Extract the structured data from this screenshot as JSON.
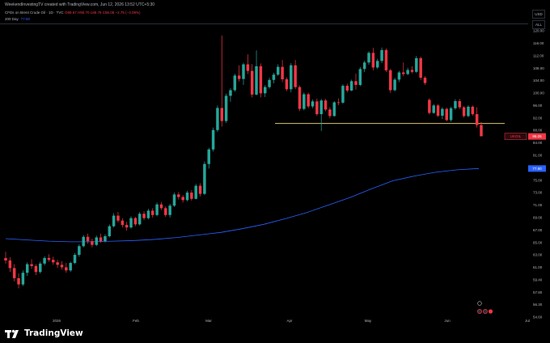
{
  "header": {
    "credit": "WeekendInvestingTV created with TradingView.com, Jun 12, 2026 13:52 UTC+5:30",
    "symbol": "CFDs on Brent Crude Oil · 1D · TVC",
    "ohlc": "O89.67 H90.70 L86.76 C86.05 −2.75 (−3.09%)",
    "ma_label": "200 Day",
    "ma_value": "77.80"
  },
  "right_top": {
    "currency": "USD",
    "mode": "ALL"
  },
  "branding": {
    "name": "TradingView"
  },
  "colors": {
    "up": "#26a69a",
    "down": "#f23645",
    "ma": "#2962ff",
    "level": "#d8c76a",
    "background": "#000000"
  },
  "chart_data": {
    "type": "candlestick",
    "ylim": [
      54.6,
      122
    ],
    "y_ticks": [
      54.6,
      56.3,
      57.8,
      59.4,
      61.0,
      63.0,
      65.0,
      67.0,
      69.0,
      71.0,
      73.0,
      75.0,
      78.0,
      81.0,
      84.0,
      88.0,
      92.0,
      96.0,
      100.0,
      104.0,
      108.0,
      112.0,
      116.0,
      120.0
    ],
    "x_ticks": [
      "2026",
      "Feb",
      "Mar",
      "Apr",
      "May",
      "Jun",
      "Jul"
    ],
    "price_label": {
      "symbol": "UKOIL",
      "value": "86.05"
    },
    "ma_price_label": "77.80",
    "horizontal_level": 90.2,
    "series": [
      {
        "name": "CFDs on Brent Crude Oil",
        "candles": [
          [
            62.5,
            63.5,
            61.6,
            62.1
          ],
          [
            62.1,
            62.6,
            60.4,
            60.9
          ],
          [
            60.9,
            61.5,
            59.2,
            59.6
          ],
          [
            59.6,
            60.2,
            58.3,
            58.8
          ],
          [
            58.8,
            60.6,
            58.6,
            60.3
          ],
          [
            60.3,
            61.8,
            59.9,
            61.5
          ],
          [
            61.5,
            62.3,
            60.8,
            61.2
          ],
          [
            61.2,
            61.5,
            60.0,
            60.4
          ],
          [
            60.4,
            61.9,
            60.2,
            61.6
          ],
          [
            61.6,
            62.8,
            61.3,
            62.5
          ],
          [
            62.5,
            63.1,
            61.9,
            62.2
          ],
          [
            62.2,
            62.7,
            61.4,
            61.8
          ],
          [
            61.8,
            62.2,
            60.9,
            61.4
          ],
          [
            61.4,
            62.0,
            60.7,
            61.0
          ],
          [
            61.0,
            61.7,
            60.3,
            60.6
          ],
          [
            60.6,
            61.9,
            60.4,
            61.7
          ],
          [
            61.7,
            63.3,
            61.5,
            63.0
          ],
          [
            63.0,
            64.7,
            62.7,
            64.4
          ],
          [
            64.4,
            66.2,
            64.2,
            65.9
          ],
          [
            65.9,
            66.4,
            64.8,
            65.2
          ],
          [
            65.2,
            65.6,
            64.2,
            64.6
          ],
          [
            64.6,
            66.1,
            64.4,
            65.8
          ],
          [
            65.8,
            66.4,
            64.9,
            65.2
          ],
          [
            65.2,
            66.3,
            65.0,
            66.0
          ],
          [
            66.0,
            67.9,
            65.8,
            67.6
          ],
          [
            67.6,
            69.7,
            67.4,
            69.3
          ],
          [
            69.3,
            69.9,
            68.2,
            68.5
          ],
          [
            68.5,
            68.9,
            67.4,
            67.8
          ],
          [
            67.8,
            68.3,
            66.9,
            67.4
          ],
          [
            67.4,
            69.2,
            67.2,
            68.9
          ],
          [
            68.9,
            69.1,
            67.6,
            67.9
          ],
          [
            67.9,
            69.9,
            67.7,
            69.6
          ],
          [
            69.6,
            70.0,
            68.6,
            68.9
          ],
          [
            68.9,
            70.4,
            68.7,
            70.1
          ],
          [
            70.1,
            70.5,
            69.0,
            69.4
          ],
          [
            69.4,
            71.4,
            69.2,
            71.1
          ],
          [
            71.1,
            71.5,
            70.2,
            70.5
          ],
          [
            70.5,
            70.8,
            69.1,
            69.4
          ],
          [
            69.4,
            71.2,
            69.0,
            70.9
          ],
          [
            70.9,
            73.0,
            70.7,
            72.7
          ],
          [
            72.7,
            73.1,
            71.9,
            72.3
          ],
          [
            72.3,
            72.6,
            71.4,
            71.8
          ],
          [
            71.8,
            73.3,
            71.6,
            73.0
          ],
          [
            73.0,
            73.4,
            71.7,
            72.0
          ],
          [
            72.0,
            74.4,
            71.9,
            74.1
          ],
          [
            74.1,
            74.5,
            72.4,
            72.8
          ],
          [
            72.8,
            79.5,
            72.6,
            78.9
          ],
          [
            78.9,
            82.8,
            77.8,
            82.4
          ],
          [
            82.4,
            88.9,
            81.9,
            88.1
          ],
          [
            88.1,
            96.0,
            87.5,
            95.2
          ],
          [
            95.2,
            118.5,
            89.2,
            91.0
          ],
          [
            91.0,
            99.8,
            90.4,
            99.1
          ],
          [
            99.1,
            101.5,
            97.2,
            100.9
          ],
          [
            100.9,
            106.2,
            100.4,
            105.6
          ],
          [
            105.6,
            108.9,
            103.7,
            104.5
          ],
          [
            104.5,
            109.7,
            102.6,
            109.2
          ],
          [
            109.2,
            112.4,
            106.1,
            107.1
          ],
          [
            107.1,
            109.3,
            98.6,
            99.5
          ],
          [
            99.5,
            113.7,
            99.2,
            108.6
          ],
          [
            108.6,
            109.5,
            98.6,
            99.9
          ],
          [
            99.9,
            102.5,
            98.7,
            101.9
          ],
          [
            101.9,
            104.9,
            101.4,
            104.2
          ],
          [
            104.2,
            106.5,
            103.1,
            105.9
          ],
          [
            105.9,
            109.2,
            105.5,
            108.4
          ],
          [
            108.4,
            110.6,
            103.5,
            104.4
          ],
          [
            104.4,
            105.0,
            100.6,
            101.2
          ],
          [
            101.2,
            109.6,
            100.2,
            108.9
          ],
          [
            108.9,
            110.6,
            101.3,
            101.9
          ],
          [
            101.9,
            102.4,
            94.2,
            94.9
          ],
          [
            94.9,
            100.2,
            94.4,
            99.6
          ],
          [
            99.6,
            100.1,
            95.1,
            95.7
          ],
          [
            95.7,
            97.9,
            95.1,
            97.3
          ],
          [
            97.3,
            98.2,
            92.6,
            93.2
          ],
          [
            93.2,
            98.1,
            87.8,
            97.6
          ],
          [
            97.6,
            98.1,
            94.1,
            94.7
          ],
          [
            94.7,
            95.4,
            91.9,
            92.6
          ],
          [
            92.6,
            97.4,
            92.4,
            97.0
          ],
          [
            97.0,
            98.3,
            96.1,
            96.9
          ],
          [
            96.9,
            102.8,
            96.5,
            102.3
          ],
          [
            102.3,
            103.0,
            100.2,
            100.8
          ],
          [
            100.8,
            104.3,
            100.6,
            103.8
          ],
          [
            103.8,
            106.2,
            101.1,
            102.6
          ],
          [
            102.6,
            108.3,
            102.2,
            107.7
          ],
          [
            107.7,
            110.4,
            106.7,
            109.8
          ],
          [
            109.8,
            113.4,
            109.1,
            112.9
          ],
          [
            112.9,
            114.5,
            107.3,
            108.2
          ],
          [
            108.2,
            111.0,
            107.7,
            110.3
          ],
          [
            110.3,
            114.6,
            109.6,
            113.8
          ],
          [
            113.8,
            114.3,
            106.7,
            107.3
          ],
          [
            107.3,
            107.8,
            100.0,
            100.9
          ],
          [
            100.9,
            104.9,
            100.5,
            104.3
          ],
          [
            104.3,
            107.1,
            103.5,
            106.6
          ],
          [
            106.6,
            109.8,
            105.4,
            106.1
          ],
          [
            106.1,
            108.1,
            105.7,
            107.4
          ],
          [
            107.4,
            108.6,
            106.3,
            106.8
          ],
          [
            106.8,
            111.9,
            106.4,
            111.2
          ],
          [
            111.2,
            111.7,
            104.2,
            104.9
          ],
          [
            104.9,
            105.4,
            102.6,
            103.2
          ],
          [
            97.8,
            98.3,
            93.1,
            93.6
          ],
          [
            93.6,
            96.5,
            93.3,
            96.0
          ],
          [
            96.0,
            96.4,
            92.3,
            92.7
          ],
          [
            92.7,
            95.4,
            91.6,
            94.9
          ],
          [
            94.9,
            95.3,
            90.9,
            91.3
          ],
          [
            91.3,
            95.6,
            90.8,
            95.1
          ],
          [
            95.1,
            98.0,
            94.6,
            97.4
          ],
          [
            97.4,
            98.1,
            94.8,
            95.4
          ],
          [
            95.4,
            95.8,
            92.1,
            92.6
          ],
          [
            92.6,
            96.1,
            92.2,
            95.6
          ],
          [
            95.6,
            96.0,
            92.7,
            93.2
          ],
          [
            93.2,
            95.4,
            88.9,
            89.7
          ],
          [
            89.7,
            90.7,
            86.8,
            86.1
          ]
        ]
      }
    ],
    "moving_average": {
      "name": "200 Day",
      "values": [
        65.6,
        65.4,
        65.2,
        65.1,
        65.1,
        65.2,
        65.3,
        65.5,
        65.8,
        66.2,
        66.6,
        67.2,
        67.9,
        68.8,
        69.8,
        71.0,
        72.2,
        73.6,
        74.9,
        76.0,
        76.9,
        77.5,
        77.8
      ]
    }
  }
}
